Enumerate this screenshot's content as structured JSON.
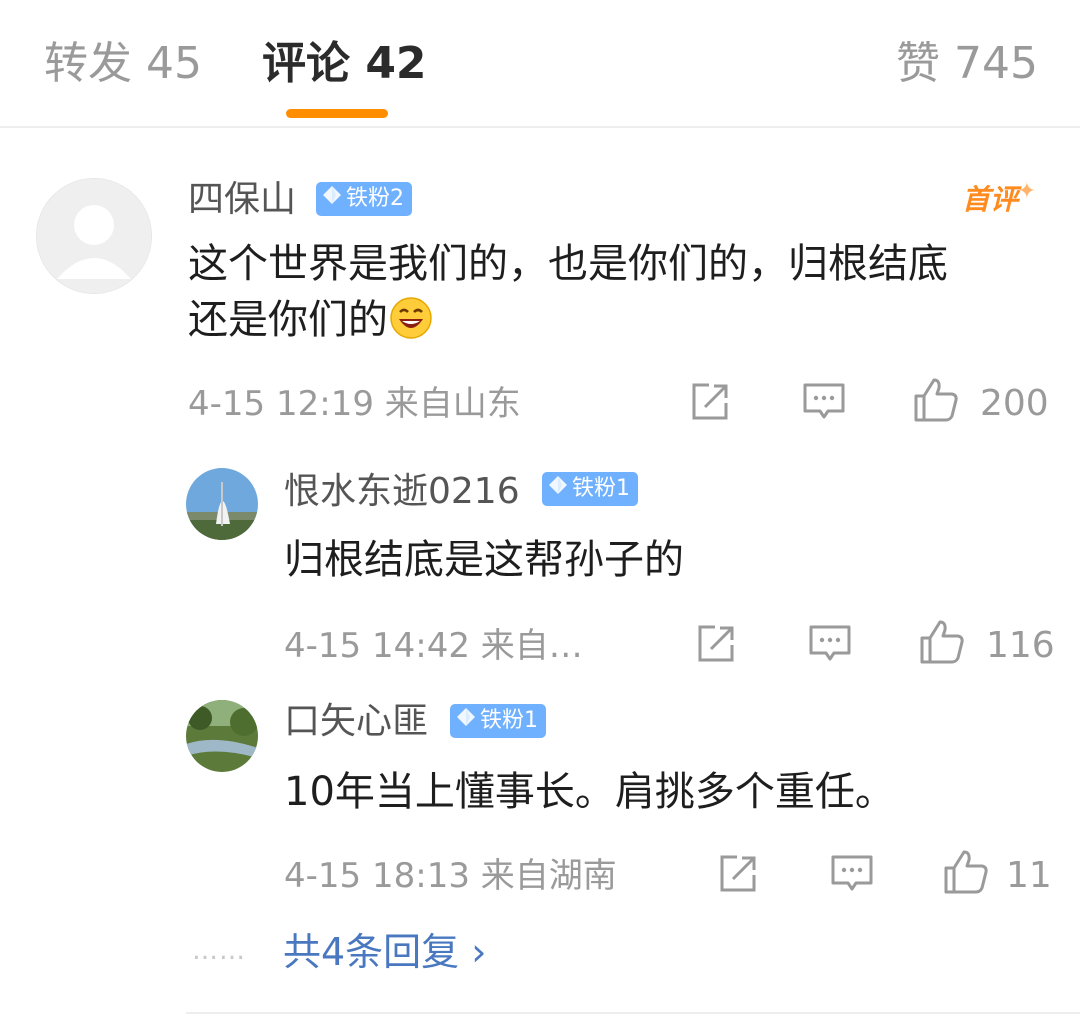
{
  "tabs": {
    "repost": "转发 45",
    "comment": "评论 42",
    "like": "赞 745"
  },
  "comments": [
    {
      "username": "四保山",
      "badge": "铁粉2",
      "first_label": "首评",
      "text_line1": "这个世界是我们的，也是你们的，归根结底",
      "text_line2": "还是你们的",
      "time_location": "4-15 12:19  来自山东",
      "likes": "200"
    }
  ],
  "replies": [
    {
      "username": "恨水东逝0216",
      "badge": "铁粉1",
      "text": "归根结底是这帮孙子的",
      "time_location": "4-15 14:42  来自…",
      "likes": "116"
    },
    {
      "username": "口矢心匪",
      "badge": "铁粉1",
      "text": "10年当上懂事长。肩挑多个重任。",
      "time_location": "4-15 18:13  来自湖南",
      "likes": "11"
    }
  ],
  "more_dots": "……",
  "more_replies": "共4条回复 ›",
  "colors": {
    "accent": "#ff8d00",
    "badge": "#6fb0ff",
    "link": "#4a78c0",
    "muted": "#9a9a9a"
  }
}
